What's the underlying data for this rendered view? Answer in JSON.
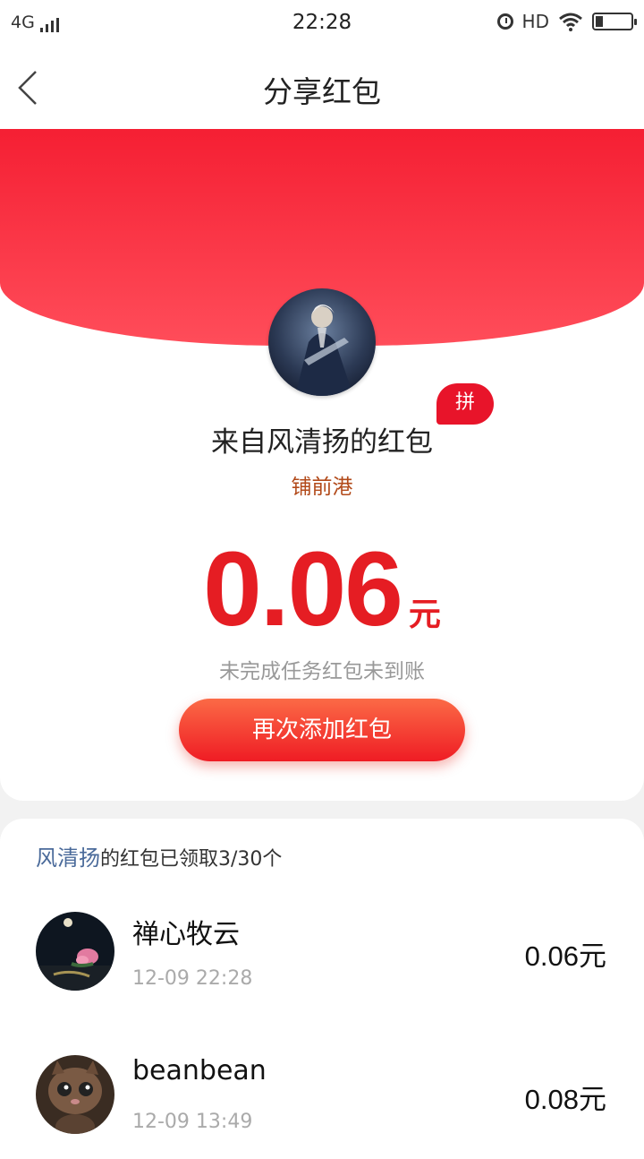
{
  "status_bar": {
    "network": "4G",
    "time": "22:28",
    "hd": "HD"
  },
  "nav": {
    "title": "分享红包"
  },
  "envelope": {
    "pin_badge": "拼",
    "from_title": "来自风清扬的红包",
    "shop_name": "铺前港",
    "amount": "0.06",
    "unit": "元",
    "status_note": "未完成任务红包未到账",
    "add_button_label": "再次添加红包"
  },
  "claims": {
    "sender": "风清扬",
    "summary_text": "的红包已领取3/30个",
    "items": [
      {
        "name": "禅心牧云",
        "time": "12-09 22:28",
        "amount": "0.06元"
      },
      {
        "name": "beanbean",
        "time": "12-09 13:49",
        "amount": "0.08元"
      }
    ]
  },
  "colors": {
    "accent_red": "#e51d23",
    "header_red": "#f51f33",
    "sender_blue": "#4a6a9a"
  }
}
